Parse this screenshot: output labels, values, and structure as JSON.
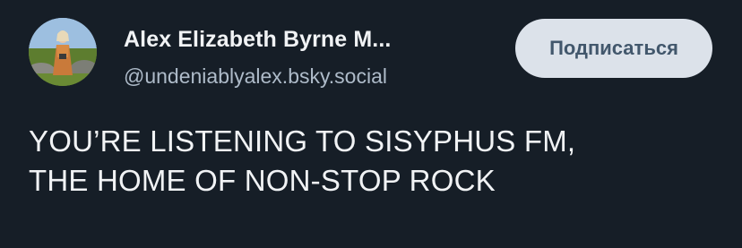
{
  "author": {
    "display_name": "Alex Elizabeth Byrne M...",
    "handle": "@undeniablyalex.bsky.social",
    "avatar_icon": "profile-photo"
  },
  "follow_button": {
    "label": "Подписаться"
  },
  "post": {
    "lines": [
      "YOU’RE LISTENING TO SISYPHUS FM,",
      "THE HOME OF NON-STOP ROCK"
    ]
  },
  "colors": {
    "background": "#161e27",
    "text": "#f1f3f5",
    "handle": "#aebbc9",
    "button_bg": "#dce2ea",
    "button_text": "#42576c"
  }
}
